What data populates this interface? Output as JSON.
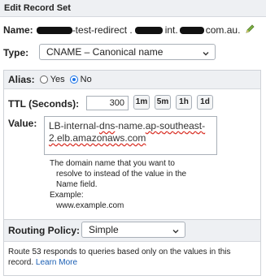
{
  "panel": {
    "title": "Edit Record Set"
  },
  "name": {
    "label": "Name:",
    "value_mid": "-test-redirect .",
    "value_mid2": "int.",
    "value_end": "com.au."
  },
  "type": {
    "label": "Type:",
    "selected": "CNAME – Canonical name"
  },
  "alias": {
    "label": "Alias:",
    "yes": "Yes",
    "no": "No",
    "selected": "No"
  },
  "ttl": {
    "label": "TTL (Seconds):",
    "value": "300",
    "buttons": [
      "1m",
      "5m",
      "1h",
      "1d"
    ]
  },
  "value_field": {
    "label": "Value:",
    "line1_a": "LB-internal-",
    "line1_b": "dns",
    "line1_c": "-name.",
    "line1_d": "ap-southeast-",
    "line2": "2.elb.amazonaws.com",
    "help": [
      "The domain name that you want to",
      "resolve to instead of the value in the",
      "Name field.",
      "Example:",
      "www.example.com"
    ]
  },
  "routing": {
    "label": "Routing Policy:",
    "selected": "Simple",
    "description": "Route 53 responds to queries based only on the values in this record.",
    "learn_more": "Learn More"
  },
  "colors": {
    "accent": "#1a73e8",
    "link": "#1a5fb4",
    "header_bg": "#eef0f3"
  }
}
